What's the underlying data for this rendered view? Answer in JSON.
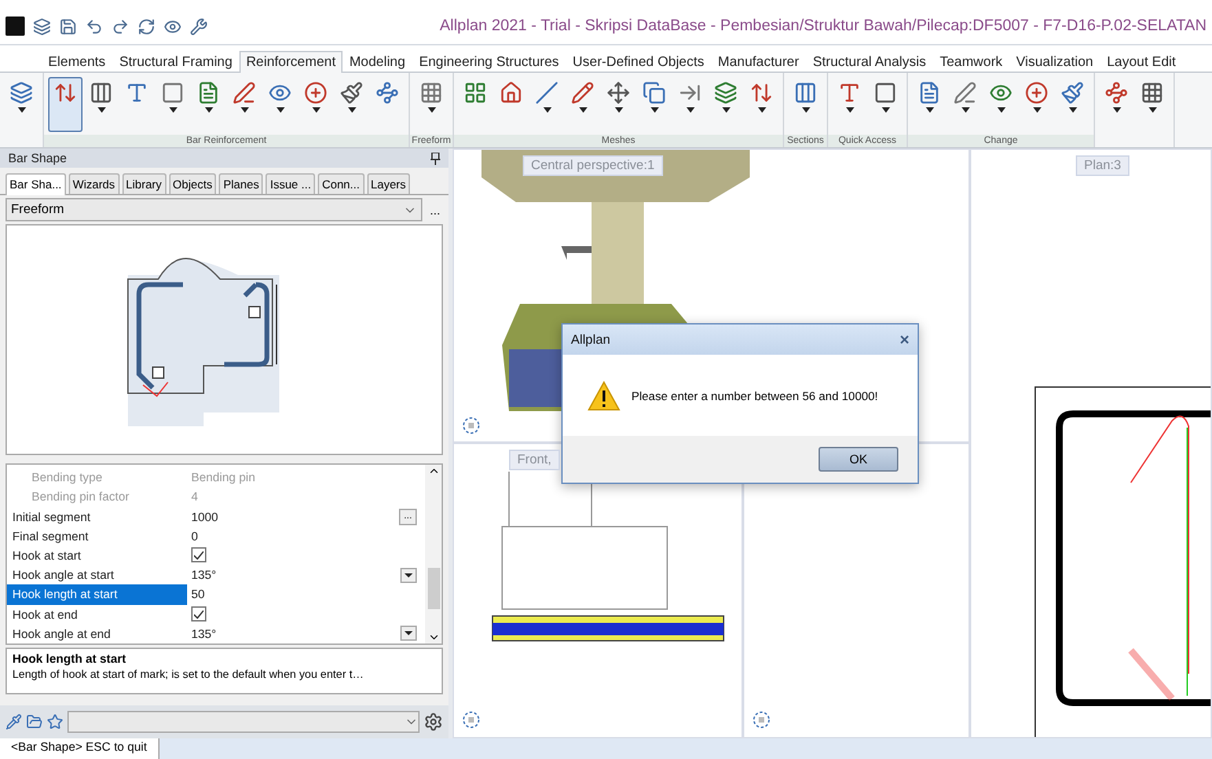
{
  "window": {
    "title": "Allplan 2021 - Trial - Skripsi DataBase - Pembesian/Struktur Bawah/Pilecap:DF5007 - F7-D16-P.02-SELATAN"
  },
  "menu_tabs": [
    {
      "label": "Elements",
      "selected": false
    },
    {
      "label": "Structural Framing",
      "selected": false
    },
    {
      "label": "Reinforcement",
      "selected": true
    },
    {
      "label": "Modeling",
      "selected": false
    },
    {
      "label": "Engineering Structures",
      "selected": false
    },
    {
      "label": "User-Defined Objects",
      "selected": false
    },
    {
      "label": "Manufacturer",
      "selected": false
    },
    {
      "label": "Structural Analysis",
      "selected": false
    },
    {
      "label": "Teamwork",
      "selected": false
    },
    {
      "label": "Visualization",
      "selected": false
    },
    {
      "label": "Layout Edit",
      "selected": false
    }
  ],
  "ribbon_groups": [
    {
      "buttons": [
        {
          "selected": false,
          "dropdown": true
        }
      ]
    },
    {
      "label": "Bar Reinforcement",
      "buttons": [
        {
          "selected": true,
          "dropdown": false
        },
        {
          "selected": false,
          "dropdown": true
        },
        {
          "selected": false,
          "dropdown": false
        },
        {
          "selected": false,
          "dropdown": true
        },
        {
          "selected": false,
          "dropdown": true
        },
        {
          "selected": false,
          "dropdown": true
        },
        {
          "selected": false,
          "dropdown": true
        },
        {
          "selected": false,
          "dropdown": true
        },
        {
          "selected": false,
          "dropdown": true
        },
        {
          "selected": false,
          "dropdown": false
        }
      ]
    },
    {
      "label": "Freeform",
      "buttons": [
        {
          "selected": false,
          "dropdown": true
        }
      ]
    },
    {
      "label": "Meshes",
      "buttons": [
        {
          "selected": false,
          "dropdown": false
        },
        {
          "selected": false,
          "dropdown": false
        },
        {
          "selected": false,
          "dropdown": true
        },
        {
          "selected": false,
          "dropdown": true
        },
        {
          "selected": false,
          "dropdown": true
        },
        {
          "selected": false,
          "dropdown": true
        },
        {
          "selected": false,
          "dropdown": true
        },
        {
          "selected": false,
          "dropdown": true
        },
        {
          "selected": false,
          "dropdown": true
        }
      ]
    },
    {
      "label": "Sections",
      "buttons": [
        {
          "selected": false,
          "dropdown": true
        }
      ]
    },
    {
      "label": "Quick Access",
      "buttons": [
        {
          "selected": false,
          "dropdown": true
        },
        {
          "selected": false,
          "dropdown": true
        }
      ]
    },
    {
      "label": "Change",
      "buttons": [
        {
          "selected": false,
          "dropdown": true
        },
        {
          "selected": false,
          "dropdown": true
        },
        {
          "selected": false,
          "dropdown": true
        },
        {
          "selected": false,
          "dropdown": true
        },
        {
          "selected": false,
          "dropdown": true
        }
      ]
    },
    {
      "buttons": [
        {
          "selected": false,
          "dropdown": true
        },
        {
          "selected": false,
          "dropdown": true
        }
      ]
    }
  ],
  "side_panel": {
    "title": "Bar Shape",
    "tabs": [
      {
        "label": "Bar Sha...",
        "selected": true
      },
      {
        "label": "Wizards",
        "selected": false
      },
      {
        "label": "Library",
        "selected": false
      },
      {
        "label": "Objects",
        "selected": false
      },
      {
        "label": "Planes",
        "selected": false
      },
      {
        "label": "Issue ...",
        "selected": false
      },
      {
        "label": "Conn...",
        "selected": false
      },
      {
        "label": "Layers",
        "selected": false
      }
    ],
    "shape_select": {
      "value": "Freeform"
    },
    "more_button": "...",
    "properties": [
      {
        "label": "Bending type",
        "value": "Bending pin",
        "kind": "text",
        "disabled": true,
        "selected": false
      },
      {
        "label": "Bending pin factor",
        "value": "4",
        "kind": "text",
        "disabled": true,
        "selected": false
      },
      {
        "label": "Initial segment",
        "value": "1000",
        "kind": "button",
        "button": "...",
        "disabled": false,
        "selected": false
      },
      {
        "label": "Final segment",
        "value": "0",
        "kind": "text",
        "disabled": false,
        "selected": false
      },
      {
        "label": "Hook at start",
        "kind": "checkbox",
        "checked": true,
        "disabled": false,
        "selected": false
      },
      {
        "label": "Hook angle at start",
        "value": "135°",
        "kind": "dropdown",
        "disabled": false,
        "selected": false
      },
      {
        "label": "Hook length at start",
        "value": "50",
        "kind": "text",
        "disabled": false,
        "selected": true
      },
      {
        "label": "Hook at end",
        "kind": "checkbox",
        "checked": true,
        "disabled": false,
        "selected": false
      },
      {
        "label": "Hook angle at end",
        "value": "135°",
        "kind": "dropdown",
        "disabled": false,
        "selected": false
      }
    ],
    "description": {
      "title": "Hook length at start",
      "text": "Length of hook at start of mark; is set to the default when you enter t…"
    }
  },
  "viewports": {
    "perspective": "Central perspective:1",
    "front": "Front,",
    "plan": "Plan:3"
  },
  "dialog": {
    "title": "Allplan",
    "close": "×",
    "message": "Please enter a number between 56 and 10000!",
    "button": "OK"
  },
  "status_bar": {
    "text": "<Bar Shape> ESC to quit"
  }
}
